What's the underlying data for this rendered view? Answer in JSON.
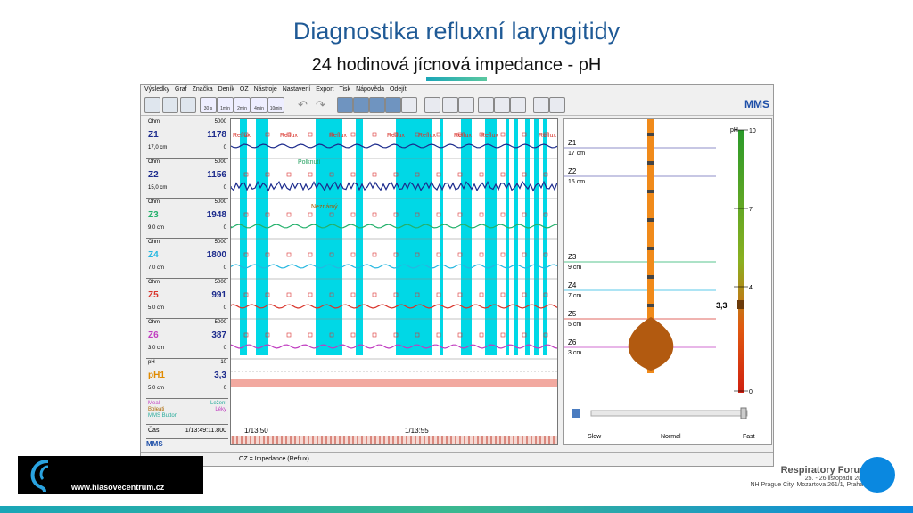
{
  "slide": {
    "title": "Diagnostika refluxní laryngitidy",
    "subtitle": "24 hodinová jícnová impedance - pH"
  },
  "app": {
    "menu": [
      "Výsledky",
      "Graf",
      "Značka",
      "Deník",
      "OZ",
      "Nástroje",
      "Nastavení",
      "Export",
      "Tisk",
      "Nápověda",
      "Odejít"
    ],
    "zoom_buttons": [
      "30 s",
      "1min",
      "2min",
      "4min",
      "10min"
    ],
    "brand": "MMS",
    "status_text": "OZ = Impedance (Reflux)"
  },
  "channels": [
    {
      "unit": "Ohm",
      "max": "5000",
      "name": "Z1",
      "value": "1178",
      "cm": "17,0 cm",
      "min": "0",
      "color": "#1b2a8c"
    },
    {
      "unit": "Ohm",
      "max": "5000",
      "name": "Z2",
      "value": "1156",
      "cm": "15,0 cm",
      "min": "0",
      "color": "#1b2a8c"
    },
    {
      "unit": "Ohm",
      "max": "5000",
      "name": "Z3",
      "value": "1948",
      "cm": "9,0 cm",
      "min": "0",
      "color": "#22b06a"
    },
    {
      "unit": "Ohm",
      "max": "5000",
      "name": "Z4",
      "value": "1800",
      "cm": "7,0 cm",
      "min": "0",
      "color": "#25b7e0"
    },
    {
      "unit": "Ohm",
      "max": "5000",
      "name": "Z5",
      "value": "991",
      "cm": "5,0 cm",
      "min": "0",
      "color": "#d9342b"
    },
    {
      "unit": "Ohm",
      "max": "5000",
      "name": "Z6",
      "value": "387",
      "cm": "3,0 cm",
      "min": "0",
      "color": "#c03cc0"
    }
  ],
  "ph_channel": {
    "unit": "pH",
    "max": "10",
    "name": "pH1",
    "value": "3,3",
    "cm": "5,0 cm",
    "min": "0"
  },
  "legend": {
    "meal": "Meal",
    "ležení": "Ležení",
    "boleati": "Boleati",
    "leky": "Léky",
    "mms_button": "MMS Button"
  },
  "time": {
    "label": "Čas",
    "current": "1/13:49:11.800",
    "tick1": "1/13:50",
    "tick2": "1/13:55"
  },
  "annotations": [
    "Reflux",
    "Polknutí",
    "Neznámý"
  ],
  "right_panel": {
    "sensors": [
      {
        "name": "Z1",
        "cm": "17 cm"
      },
      {
        "name": "Z2",
        "cm": "15 cm"
      },
      {
        "name": "Z3",
        "cm": "9 cm"
      },
      {
        "name": "Z4",
        "cm": "7 cm"
      },
      {
        "name": "Z5",
        "cm": "5 cm"
      },
      {
        "name": "Z6",
        "cm": "3 cm"
      }
    ],
    "ph_label": "pH",
    "ph_ticks": [
      "10",
      "7",
      "4",
      "0"
    ],
    "ph_value": "3,3",
    "speed": {
      "slow": "Slow",
      "normal": "Normal",
      "fast": "Fast"
    }
  },
  "footer": {
    "url": "www.hlasovecentrum.cz",
    "forum_title": "Respiratory Forum",
    "forum_date": "25. - 26.listopadu 2016",
    "forum_place": "NH Prague City, Mozartova 261/1, Praha 5"
  }
}
